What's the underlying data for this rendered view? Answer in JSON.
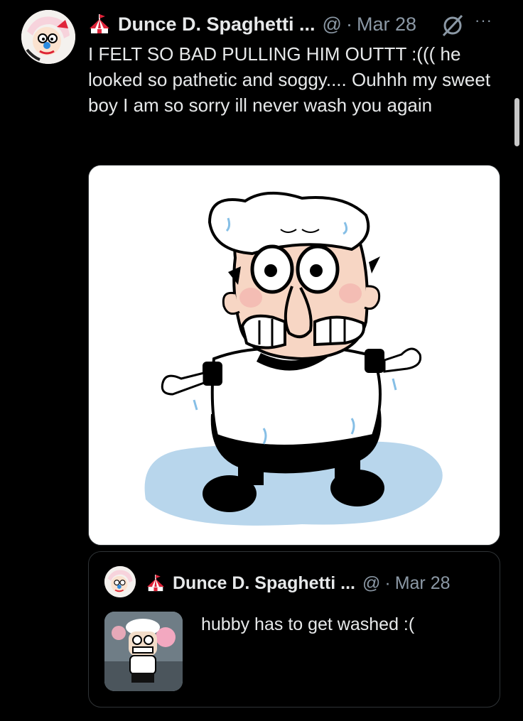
{
  "tweet": {
    "author_name": "Dunce D. Spaghetti ...",
    "handle": "@",
    "separator": "·",
    "date": "Mar 28",
    "more_label": "···",
    "text": "I FELT SO BAD PULLING HIM OUTTT :((( he looked so pathetic and soggy.... Ouhhh my sweet boy I am so sorry ill never wash you again",
    "avatar_icon": "avatar-clown-icon",
    "badge_icon": "circus-tent-icon",
    "grok_icon": "grok-icon"
  },
  "quoted_tweet": {
    "author_name": "Dunce D. Spaghetti ...",
    "handle": "@",
    "separator": "·",
    "date": "Mar 28",
    "text": "hubby has to get washed :("
  },
  "colors": {
    "background": "#000000",
    "text": "#e7e9ea",
    "muted": "#8b98a5",
    "tent_red": "#e0243a",
    "puddle": "#b8d6ec"
  }
}
